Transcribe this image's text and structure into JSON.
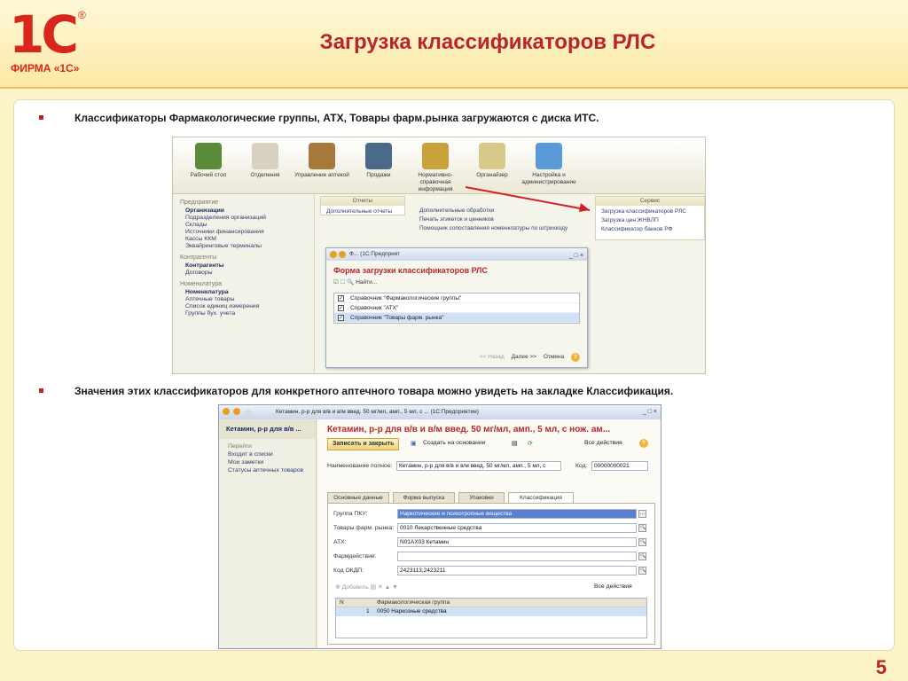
{
  "slide": {
    "logo_main": "1С",
    "logo_reg": "®",
    "logo_sub": "ФИРМА «1С»",
    "title": "Загрузка классификаторов РЛС",
    "page_number": "5",
    "bullet1": "Классификаторы Фармакологические группы, АТХ, Товары фарм.рынка загружаются с диска ИТС.",
    "bullet2": "Значения этих классификаторов для конкретного аптечного товара можно увидеть на закладке Классификация."
  },
  "shot1": {
    "toolbar": [
      {
        "label": "Рабочий стол",
        "icon": "desktop-icon",
        "color": "#5a8a3a"
      },
      {
        "label": "Отделения",
        "icon": "medical-icon",
        "color": "#d8d0c0"
      },
      {
        "label": "Управление аптекой",
        "icon": "boxes-icon",
        "color": "#a8783a"
      },
      {
        "label": "Продажи",
        "icon": "cash-register-icon",
        "color": "#4a6a8a"
      },
      {
        "label": "Нормативно-справочная информация",
        "icon": "books-icon",
        "color": "#c8a23a"
      },
      {
        "label": "Органайзер",
        "icon": "clipboard-icon",
        "color": "#d8c88a"
      },
      {
        "label": "Настройка и администрирование",
        "icon": "computer-icon",
        "color": "#5a9ad8"
      }
    ],
    "sidebar": {
      "sections": [
        {
          "header": "Предприятие",
          "items": [
            "Организации",
            "Подразделения организаций",
            "Склады",
            "Источники финансирования",
            "Кассы ККМ",
            "Эквайринговые терминалы"
          ],
          "bold": "Организации"
        },
        {
          "header": "Контрагенты",
          "items": [
            "Контрагенты",
            "Договоры"
          ],
          "bold": "Контрагенты"
        },
        {
          "header": "Номенклатура",
          "items": [
            "Номенклатура",
            "Аптечные товары",
            "Список единиц измерения",
            "Группы бух. учета"
          ],
          "bold": "Номенклатура"
        }
      ]
    },
    "panel_reports": {
      "header": "Отчеты",
      "items": [
        "Дополнительные отчеты"
      ]
    },
    "panel_processing": {
      "items": [
        "Дополнительные обработки",
        "Печать этикеток и ценников",
        "Помощник сопоставления номенклатуры по штрихкоду"
      ]
    },
    "panel_service": {
      "header": "Сервис",
      "items": [
        "Загрузка классификаторов РЛС",
        "Загрузка цен ЖНВЛП",
        "Классификатор банков РФ"
      ]
    },
    "dialog": {
      "titlebar": "Ф... (1С:Предприят",
      "heading": "Форма загрузки классификаторов РЛС",
      "find_label": "Найти...",
      "rows": [
        {
          "label": "Справочник \"Фармакологические группы\"",
          "checked": true,
          "selected": false
        },
        {
          "label": "Справочник \"АТХ\"",
          "checked": true,
          "selected": false
        },
        {
          "label": "Справочник \"Товары фарм. рынка\"",
          "checked": true,
          "selected": true
        }
      ],
      "back": "<< Назад",
      "next": "Далее >>",
      "cancel": "Отмена",
      "help": "?"
    }
  },
  "shot2": {
    "titlebar": "Кетамин, р-р для в/в и в/м введ. 50 мг/мл, амп., 5 мл, с ...  (1С:Предприятие)",
    "sidebar": {
      "header": "Кетамин, р-р для в/в ...",
      "section": "Перейти",
      "items": [
        "Входит в списки",
        "Мои заметки",
        "Статусы аптечных товаров"
      ]
    },
    "form_title": "Кетамин, р-р для в/в и в/м введ. 50 мг/мл, амп., 5 мл, с нож. ам...",
    "save_close": "Записать и закрыть",
    "create_based": "Создать на основании",
    "all_actions": "Все действия",
    "full_name_label": "Наименование полное:",
    "full_name_value": "Кетамин, р-р для в/в и в/м введ. 50 мг/мл, амп., 5 мл, с",
    "code_label": "Код:",
    "code_value": "00000000021",
    "tabs": [
      "Основные данные",
      "Форма выпуска",
      "Упаковки",
      "Классификация"
    ],
    "fields": [
      {
        "label": "Группа ПКУ:",
        "value": "Наркотические и психотропные вещества",
        "highlight": true
      },
      {
        "label": "Товары фарм. рынка:",
        "value": "0010 Лекарственные средства",
        "highlight": false
      },
      {
        "label": "АТХ:",
        "value": "N01AX03 Кетамин",
        "highlight": false
      },
      {
        "label": "Фармдействие:",
        "value": "",
        "highlight": false
      },
      {
        "label": "Код ОКДП:",
        "value": "2423113,2423211",
        "highlight": false
      }
    ],
    "add_label": "Добавить",
    "grid_all_actions": "Все действия",
    "grid_headers": [
      "N",
      "Фармакологическая группа"
    ],
    "grid_rows": [
      [
        "1",
        "0050 Наркозные средства"
      ]
    ]
  }
}
